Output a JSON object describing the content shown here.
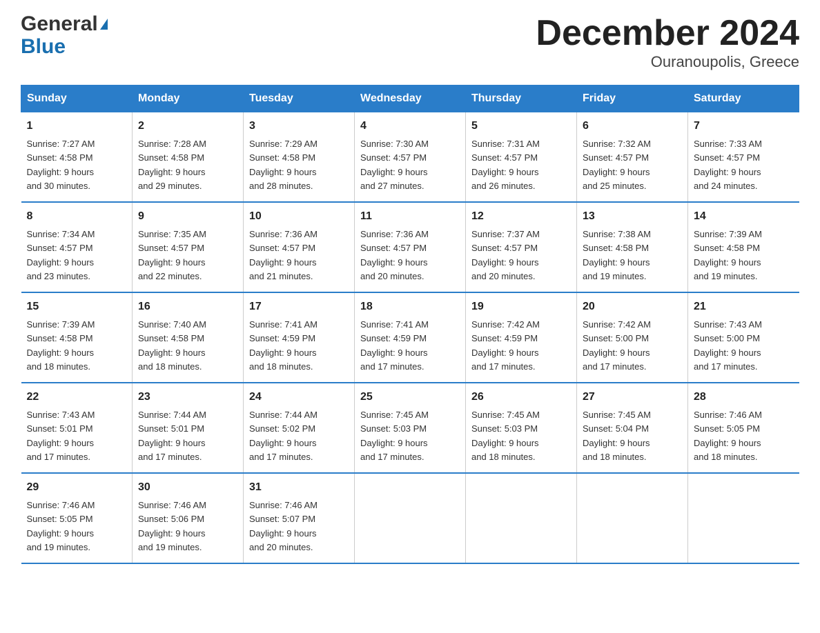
{
  "header": {
    "logo_line1": "General",
    "logo_line2": "Blue",
    "title": "December 2024",
    "subtitle": "Ouranoupolis, Greece"
  },
  "weekdays": [
    "Sunday",
    "Monday",
    "Tuesday",
    "Wednesday",
    "Thursday",
    "Friday",
    "Saturday"
  ],
  "weeks": [
    [
      {
        "day": "1",
        "sunrise": "7:27 AM",
        "sunset": "4:58 PM",
        "daylight": "9 hours and 30 minutes."
      },
      {
        "day": "2",
        "sunrise": "7:28 AM",
        "sunset": "4:58 PM",
        "daylight": "9 hours and 29 minutes."
      },
      {
        "day": "3",
        "sunrise": "7:29 AM",
        "sunset": "4:58 PM",
        "daylight": "9 hours and 28 minutes."
      },
      {
        "day": "4",
        "sunrise": "7:30 AM",
        "sunset": "4:57 PM",
        "daylight": "9 hours and 27 minutes."
      },
      {
        "day": "5",
        "sunrise": "7:31 AM",
        "sunset": "4:57 PM",
        "daylight": "9 hours and 26 minutes."
      },
      {
        "day": "6",
        "sunrise": "7:32 AM",
        "sunset": "4:57 PM",
        "daylight": "9 hours and 25 minutes."
      },
      {
        "day": "7",
        "sunrise": "7:33 AM",
        "sunset": "4:57 PM",
        "daylight": "9 hours and 24 minutes."
      }
    ],
    [
      {
        "day": "8",
        "sunrise": "7:34 AM",
        "sunset": "4:57 PM",
        "daylight": "9 hours and 23 minutes."
      },
      {
        "day": "9",
        "sunrise": "7:35 AM",
        "sunset": "4:57 PM",
        "daylight": "9 hours and 22 minutes."
      },
      {
        "day": "10",
        "sunrise": "7:36 AM",
        "sunset": "4:57 PM",
        "daylight": "9 hours and 21 minutes."
      },
      {
        "day": "11",
        "sunrise": "7:36 AM",
        "sunset": "4:57 PM",
        "daylight": "9 hours and 20 minutes."
      },
      {
        "day": "12",
        "sunrise": "7:37 AM",
        "sunset": "4:57 PM",
        "daylight": "9 hours and 20 minutes."
      },
      {
        "day": "13",
        "sunrise": "7:38 AM",
        "sunset": "4:58 PM",
        "daylight": "9 hours and 19 minutes."
      },
      {
        "day": "14",
        "sunrise": "7:39 AM",
        "sunset": "4:58 PM",
        "daylight": "9 hours and 19 minutes."
      }
    ],
    [
      {
        "day": "15",
        "sunrise": "7:39 AM",
        "sunset": "4:58 PM",
        "daylight": "9 hours and 18 minutes."
      },
      {
        "day": "16",
        "sunrise": "7:40 AM",
        "sunset": "4:58 PM",
        "daylight": "9 hours and 18 minutes."
      },
      {
        "day": "17",
        "sunrise": "7:41 AM",
        "sunset": "4:59 PM",
        "daylight": "9 hours and 18 minutes."
      },
      {
        "day": "18",
        "sunrise": "7:41 AM",
        "sunset": "4:59 PM",
        "daylight": "9 hours and 17 minutes."
      },
      {
        "day": "19",
        "sunrise": "7:42 AM",
        "sunset": "4:59 PM",
        "daylight": "9 hours and 17 minutes."
      },
      {
        "day": "20",
        "sunrise": "7:42 AM",
        "sunset": "5:00 PM",
        "daylight": "9 hours and 17 minutes."
      },
      {
        "day": "21",
        "sunrise": "7:43 AM",
        "sunset": "5:00 PM",
        "daylight": "9 hours and 17 minutes."
      }
    ],
    [
      {
        "day": "22",
        "sunrise": "7:43 AM",
        "sunset": "5:01 PM",
        "daylight": "9 hours and 17 minutes."
      },
      {
        "day": "23",
        "sunrise": "7:44 AM",
        "sunset": "5:01 PM",
        "daylight": "9 hours and 17 minutes."
      },
      {
        "day": "24",
        "sunrise": "7:44 AM",
        "sunset": "5:02 PM",
        "daylight": "9 hours and 17 minutes."
      },
      {
        "day": "25",
        "sunrise": "7:45 AM",
        "sunset": "5:03 PM",
        "daylight": "9 hours and 17 minutes."
      },
      {
        "day": "26",
        "sunrise": "7:45 AM",
        "sunset": "5:03 PM",
        "daylight": "9 hours and 18 minutes."
      },
      {
        "day": "27",
        "sunrise": "7:45 AM",
        "sunset": "5:04 PM",
        "daylight": "9 hours and 18 minutes."
      },
      {
        "day": "28",
        "sunrise": "7:46 AM",
        "sunset": "5:05 PM",
        "daylight": "9 hours and 18 minutes."
      }
    ],
    [
      {
        "day": "29",
        "sunrise": "7:46 AM",
        "sunset": "5:05 PM",
        "daylight": "9 hours and 19 minutes."
      },
      {
        "day": "30",
        "sunrise": "7:46 AM",
        "sunset": "5:06 PM",
        "daylight": "9 hours and 19 minutes."
      },
      {
        "day": "31",
        "sunrise": "7:46 AM",
        "sunset": "5:07 PM",
        "daylight": "9 hours and 20 minutes."
      },
      null,
      null,
      null,
      null
    ]
  ],
  "labels": {
    "sunrise": "Sunrise:",
    "sunset": "Sunset:",
    "daylight": "Daylight:"
  }
}
